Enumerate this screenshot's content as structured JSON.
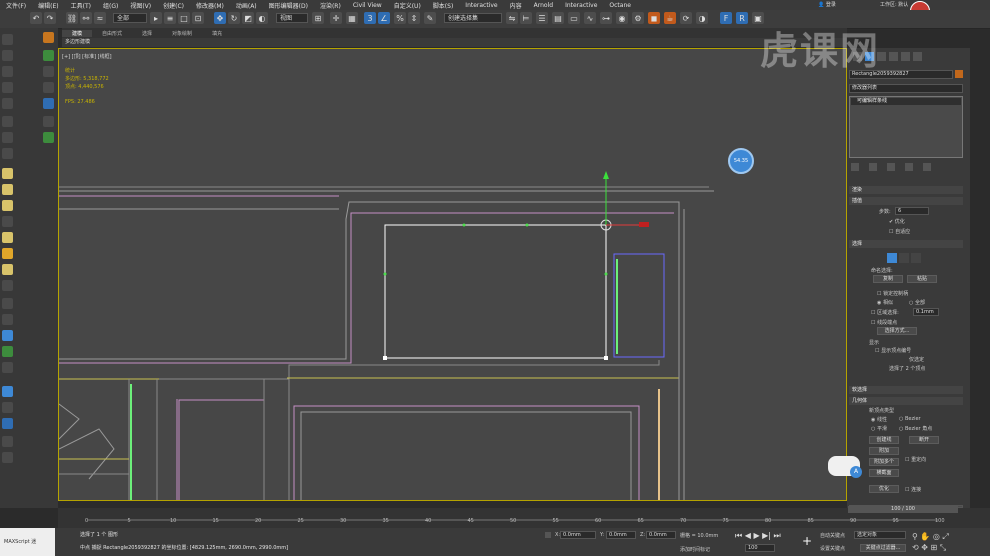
{
  "menubar": {
    "items": [
      "文件(F)",
      "编辑(E)",
      "工具(T)",
      "组(G)",
      "视图(V)",
      "创建(C)",
      "修改器(M)",
      "动画(A)",
      "图形编辑器(D)",
      "渲染(R)",
      "Civil View",
      "自定义(U)",
      "脚本(S)",
      "Interactive",
      "内容",
      "Arnold",
      "Interactive",
      "Octane"
    ],
    "login": "登录",
    "workspace": "工作区: 默认"
  },
  "toolbar": {
    "selection_filter": "全部",
    "ref_coord": "视图",
    "named_selection": "创建选择集"
  },
  "ribbon": {
    "tabs": [
      "建模",
      "自由形式",
      "选择",
      "对象绘制",
      "填充"
    ],
    "subtitle": "多边形建模"
  },
  "viewport": {
    "label": "[+] [顶] [标准] [线框]",
    "stats_title": "统计",
    "polygons_label": "多边形:",
    "polygons_value": "5,318,772",
    "vertices_label": "顶点:",
    "vertices_value": "4,440,576",
    "fps_label": "FPS:",
    "fps_value": "27.486",
    "badge": "54.35"
  },
  "command_panel": {
    "object_name": "Rectangle2059392827",
    "modifier_list": "修改器列表",
    "stack_item": "可编辑样条线",
    "rollout_render": "渲染",
    "rollout_interp": "插值",
    "steps_label": "步数:",
    "steps_value": "6",
    "optimize": "优化",
    "adaptive": "自适应",
    "rollout_select": "选择",
    "named_sel": "命名选择:",
    "copy": "复制",
    "paste": "粘贴",
    "lock_handles": "锁定控制柄",
    "similar": "相似",
    "all": "全部",
    "area_select": "区域选择:",
    "area_value": "0.1mm",
    "segment_end": "线段端点",
    "select_by": "选择方式...",
    "display": "显示",
    "show_vertex_numbers": "显示顶点编号",
    "selected_only": "仅选定",
    "selected_count": "选择了 2 个顶点",
    "rollout_soft": "软选择",
    "rollout_geometry": "几何体",
    "new_vertex_type": "新顶点类型",
    "linear": "线性",
    "bezier": "Bezier",
    "smooth": "平滑",
    "bezier_corner": "Bezier 角点",
    "create_line": "创建线",
    "break": "断开",
    "attach": "附加",
    "attach_multi": "附加多个",
    "reorient": "重定向",
    "cross_section": "横截面",
    "refine": "优化",
    "connect": "连接",
    "frame_counter": "100 / 100"
  },
  "timeline": {
    "ticks": [
      "0",
      "5",
      "10",
      "15",
      "20",
      "25",
      "30",
      "35",
      "40",
      "45",
      "50",
      "55",
      "60",
      "65",
      "70",
      "75",
      "80",
      "85",
      "90",
      "95",
      "100"
    ]
  },
  "status": {
    "script_label": "MAXScript 迷",
    "selection_text": "选择了 1 个 图形",
    "prompt_text": "中点 捕捉 Rectangle2059392827 的坐标位置: [4829.125mm, 2690.0mm, 2990.0mm]",
    "x_label": "X:",
    "x_value": "0.0mm",
    "y_label": "Y:",
    "y_value": "0.0mm",
    "z_label": "Z:",
    "z_value": "0.0mm",
    "grid_label": "栅格 = 10.0mm",
    "add_time_tag": "添加时间标记",
    "auto_key": "自动关键点",
    "selected_obj": "选定对象",
    "set_key": "设置关键点",
    "key_filters": "关键点过滤器...",
    "frame": "100"
  },
  "watermark": "虎课网"
}
